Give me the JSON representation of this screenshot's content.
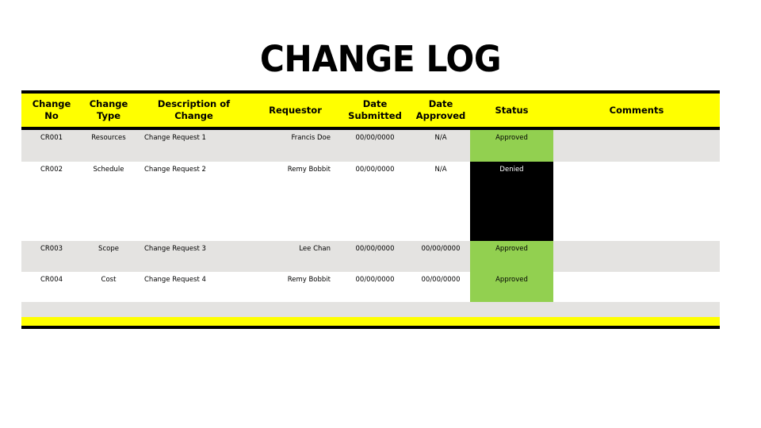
{
  "slide": {
    "title": "CHANGE LOG",
    "background_color": "#FFFFFF"
  },
  "theme": {
    "header_fill": "#FFFF00",
    "rule_color": "#000000",
    "stripe_fill": "#E4E3E1",
    "approved_fill": "#92D050",
    "denied_fill": "#000000",
    "denied_text": "#FFFFFF",
    "body_text": "#000000"
  },
  "table": {
    "columns": [
      {
        "key": "change_no",
        "label_line1": "Change",
        "label_line2": "No",
        "align": "center"
      },
      {
        "key": "change_type",
        "label_line1": "Change",
        "label_line2": "Type",
        "align": "center"
      },
      {
        "key": "description",
        "label_line1": "Description of",
        "label_line2": "Change",
        "align": "left"
      },
      {
        "key": "requestor",
        "label_line1": "Requestor",
        "label_line2": "",
        "align": "right"
      },
      {
        "key": "date_submitted",
        "label_line1": "Date",
        "label_line2": "Submitted",
        "align": "center"
      },
      {
        "key": "date_approved",
        "label_line1": "Date",
        "label_line2": "Approved",
        "align": "center"
      },
      {
        "key": "status",
        "label_line1": "Status",
        "label_line2": "",
        "align": "center"
      },
      {
        "key": "comments",
        "label_line1": "Comments",
        "label_line2": "",
        "align": "center"
      }
    ],
    "rows": [
      {
        "change_no": "CR001",
        "change_type": "Resources",
        "description": "Change Request 1",
        "requestor": "Francis Doe",
        "date_submitted": "00/00/0000",
        "date_approved": "N/A",
        "status": "Approved",
        "status_state": "approved",
        "comments": ""
      },
      {
        "change_no": "CR002",
        "change_type": "Schedule",
        "description": "Change Request 2",
        "requestor": "Remy Bobbit",
        "date_submitted": "00/00/0000",
        "date_approved": "N/A",
        "status": "Denied",
        "status_state": "denied",
        "comments": ""
      },
      {
        "change_no": "CR003",
        "change_type": "Scope",
        "description": "Change Request 3",
        "requestor": "Lee Chan",
        "date_submitted": "00/00/0000",
        "date_approved": "00/00/0000",
        "status": "Approved",
        "status_state": "approved",
        "comments": ""
      },
      {
        "change_no": "CR004",
        "change_type": "Cost",
        "description": "Change Request 4",
        "requestor": "Remy Bobbit",
        "date_submitted": "00/00/0000",
        "date_approved": "00/00/0000",
        "status": "Approved",
        "status_state": "approved",
        "comments": ""
      }
    ]
  }
}
